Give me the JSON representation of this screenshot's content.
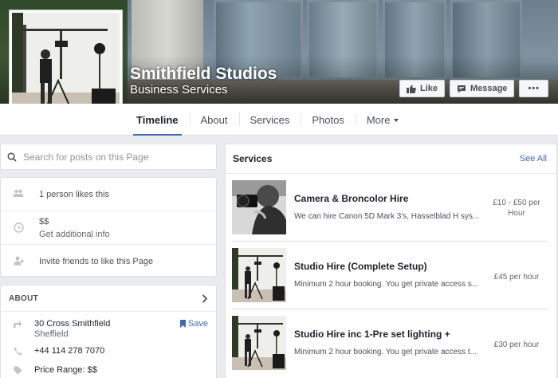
{
  "page": {
    "name": "Smithfield Studios",
    "category": "Business Services"
  },
  "cover_buttons": {
    "like": "Like",
    "message": "Message",
    "more": "•••"
  },
  "nav": {
    "tabs": [
      "Timeline",
      "About",
      "Services",
      "Photos",
      "More"
    ],
    "active": "Timeline"
  },
  "search": {
    "placeholder": "Search for posts on this Page"
  },
  "info": {
    "likes": "1 person likes this",
    "price": "$$",
    "additional": "Get additional info",
    "invite": "Invite friends to like this Page"
  },
  "about": {
    "title": "ABOUT",
    "address_line1": "30 Cross Smithfield",
    "address_line2": "Sheffield",
    "save": "Save",
    "phone": "+44 114 278 7070",
    "price_range": "Price Range: $$"
  },
  "services": {
    "title": "Services",
    "see_all": "See All",
    "items": [
      {
        "name": "Camera & Broncolor Hire",
        "description": "We can hire Canon 5D Mark 3's, Hasselblad H sys...",
        "price_line1": "£10 - £50 per",
        "price_line2": "Hour"
      },
      {
        "name": "Studio Hire (Complete Setup)",
        "description": "Minimum 2 hour booking. You get private access s...",
        "price_line1": "£45 per hour",
        "price_line2": ""
      },
      {
        "name": "Studio Hire inc 1-Pre set lighting +",
        "description": "Minimum 2 hour booking. You get private access t...",
        "price_line1": "£30 per hour",
        "price_line2": ""
      }
    ]
  },
  "colors": {
    "accent": "#4267b2",
    "background": "#e9ebee"
  }
}
